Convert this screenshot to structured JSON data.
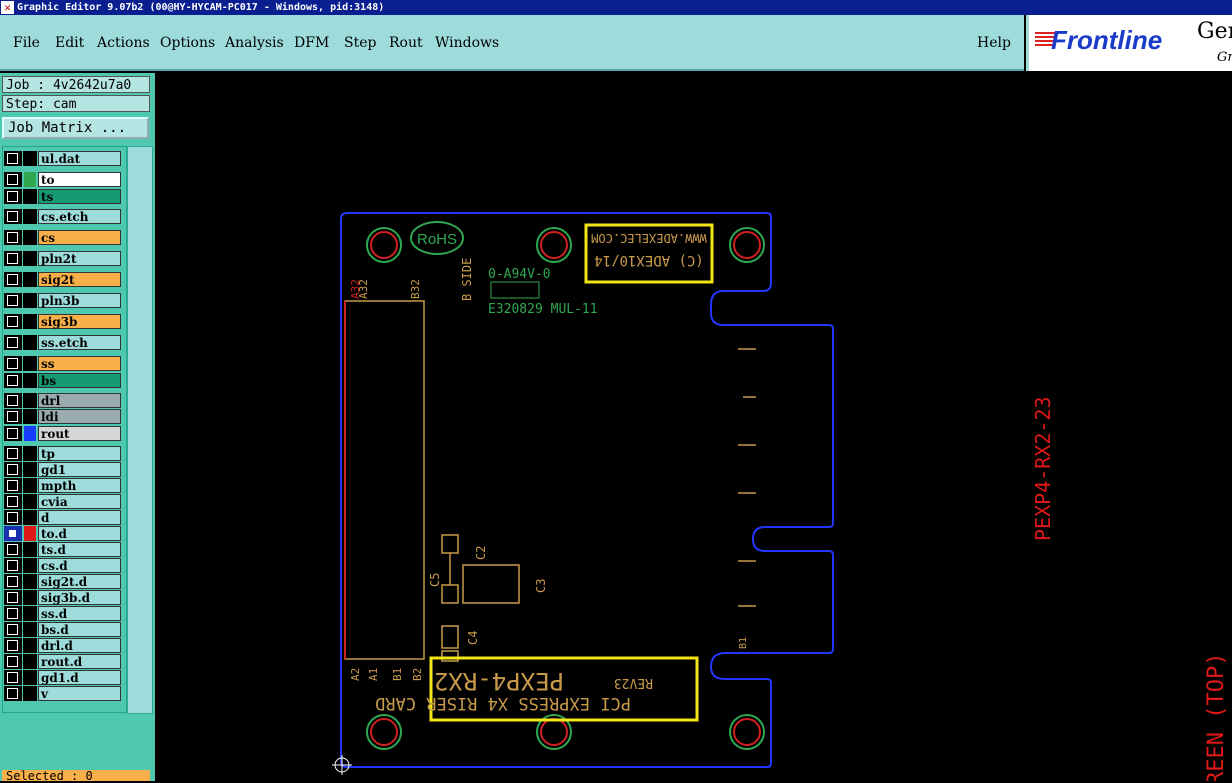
{
  "window": {
    "title": "Graphic Editor 9.07b2 (00@HY-HYCAM-PC017 - Windows, pid:3148)"
  },
  "menu": {
    "file": "File",
    "edit": "Edit",
    "actions": "Actions",
    "options": "Options",
    "analysis": "Analysis",
    "dfm": "DFM",
    "step": "Step",
    "rout": "Rout",
    "windows": "Windows",
    "help": "Help"
  },
  "brand": {
    "logo": "Frontline",
    "gen": "Gen",
    "gr": "Gr"
  },
  "job": {
    "job": "Job : 4v2642u7a0",
    "step": "Step: cam",
    "matrix": "Job Matrix ..."
  },
  "layers": [
    {
      "name": "ul.dat",
      "color": "#9edcdc",
      "swatch": "#000"
    },
    {
      "name": "to",
      "color": "#ffffff",
      "swatch": "#2fa84f"
    },
    {
      "name": "ts",
      "color": "#159a72",
      "swatch": "#000"
    },
    {
      "name": "cs.etch",
      "color": "#9edcdc",
      "swatch": "#000"
    },
    {
      "name": "cs",
      "color": "#f9b04a",
      "swatch": "#000"
    },
    {
      "name": "pln2t",
      "color": "#9edcdc",
      "swatch": "#000"
    },
    {
      "name": "sig2t",
      "color": "#f9b04a",
      "swatch": "#000"
    },
    {
      "name": "pln3b",
      "color": "#9edcdc",
      "swatch": "#000"
    },
    {
      "name": "sig3b",
      "color": "#f9b04a",
      "swatch": "#000"
    },
    {
      "name": "ss.etch",
      "color": "#9edcdc",
      "swatch": "#000"
    },
    {
      "name": "ss",
      "color": "#f9b04a",
      "swatch": "#000"
    },
    {
      "name": "bs",
      "color": "#159a72",
      "swatch": "#000"
    },
    {
      "name": "drl",
      "color": "#9aabb0",
      "swatch": "#000"
    },
    {
      "name": "ldi",
      "color": "#9aabb0",
      "swatch": "#000"
    },
    {
      "name": "rout",
      "color": "#d6d6d6",
      "swatch": "#1a3cff"
    },
    {
      "name": "tp",
      "color": "#9edcdc",
      "swatch": "#000"
    },
    {
      "name": "gd1",
      "color": "#9edcdc",
      "swatch": "#000"
    },
    {
      "name": "mpth",
      "color": "#9edcdc",
      "swatch": "#000"
    },
    {
      "name": "cvia",
      "color": "#9edcdc",
      "swatch": "#000"
    },
    {
      "name": "d",
      "color": "#9edcdc",
      "swatch": "#000"
    },
    {
      "name": "to.d",
      "color": "#9edcdc",
      "swatch": "#e01818"
    },
    {
      "name": "ts.d",
      "color": "#9edcdc",
      "swatch": "#000"
    },
    {
      "name": "cs.d",
      "color": "#9edcdc",
      "swatch": "#000"
    },
    {
      "name": "sig2t.d",
      "color": "#9edcdc",
      "swatch": "#000"
    },
    {
      "name": "sig3b.d",
      "color": "#9edcdc",
      "swatch": "#000"
    },
    {
      "name": "ss.d",
      "color": "#9edcdc",
      "swatch": "#000"
    },
    {
      "name": "bs.d",
      "color": "#9edcdc",
      "swatch": "#000"
    },
    {
      "name": "drl.d",
      "color": "#9edcdc",
      "swatch": "#000"
    },
    {
      "name": "rout.d",
      "color": "#9edcdc",
      "swatch": "#000"
    },
    {
      "name": "gd1.d",
      "color": "#9edcdc",
      "swatch": "#000"
    },
    {
      "name": "v",
      "color": "#9edcdc",
      "swatch": "#000"
    }
  ],
  "status": {
    "selected": "Selected : 0"
  },
  "board": {
    "copyright": "(C) ADEX10/14",
    "website": "WWW.ADEXELEC.COM",
    "rohs": "RoHS",
    "bside": "B SIDE",
    "ul_mark": "0-A94V-0",
    "ul_code": "E320829 MUL-11",
    "part": "PEXP4-RX2",
    "rev": "REV23",
    "desc": "PCI EXPRESS X4 RISER CARD",
    "side_label": "PEXP4-RX2-23",
    "screen_label": "REEN (TOP)",
    "c2": "C2",
    "c3": "C3",
    "c4": "C4",
    "c5": "C5",
    "a32": "A32",
    "b32": "B32",
    "a2": "A2",
    "a1": "A1",
    "b1": "B1",
    "b2": "B2",
    "b1r": "B1"
  }
}
